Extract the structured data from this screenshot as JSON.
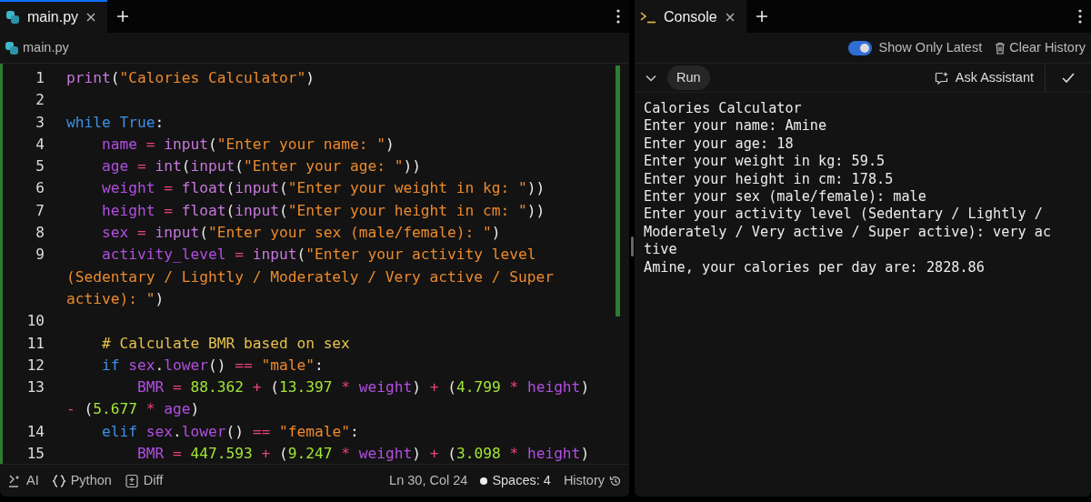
{
  "editor": {
    "tabs": [
      {
        "label": "main.py",
        "selected": true,
        "focused": true
      }
    ],
    "breadcrumb": "main.py",
    "lines": [
      {
        "number": "1",
        "rows": [
          {
            "tokens": [
              {
                "text": "print",
                "kind": "fn"
              },
              {
                "text": "(",
                "kind": "pun"
              },
              {
                "text": "\"Calories Calculator\"",
                "kind": "str"
              },
              {
                "text": ")",
                "kind": "pun"
              }
            ]
          }
        ]
      },
      {
        "number": "2",
        "rows": [
          {}
        ]
      },
      {
        "number": "3",
        "rows": [
          {
            "tokens": [
              {
                "text": "while",
                "kind": "kw"
              },
              {
                "text": " True",
                "kind": "kw"
              },
              {
                "text": ":",
                "kind": "pun"
              }
            ]
          }
        ]
      },
      {
        "number": "4",
        "rows": [
          {
            "tokens": [
              {
                "text": "    name",
                "kind": "var"
              },
              {
                "text": " = ",
                "kind": "op"
              },
              {
                "text": "input",
                "kind": "fn"
              },
              {
                "text": "(",
                "kind": "pun"
              },
              {
                "text": "\"Enter your name: \"",
                "kind": "str"
              },
              {
                "text": ")",
                "kind": "pun"
              }
            ]
          }
        ]
      },
      {
        "number": "5",
        "rows": [
          {
            "tokens": [
              {
                "text": "    age",
                "kind": "var"
              },
              {
                "text": " = ",
                "kind": "op"
              },
              {
                "text": "int",
                "kind": "fn"
              },
              {
                "text": "(",
                "kind": "pun"
              },
              {
                "text": "input",
                "kind": "fn"
              },
              {
                "text": "(",
                "kind": "pun"
              },
              {
                "text": "\"Enter your age: \"",
                "kind": "str"
              },
              {
                "text": "))",
                "kind": "pun"
              }
            ]
          }
        ]
      },
      {
        "number": "6",
        "rows": [
          {
            "tokens": [
              {
                "text": "    weight",
                "kind": "var"
              },
              {
                "text": " = ",
                "kind": "op"
              },
              {
                "text": "float",
                "kind": "fn"
              },
              {
                "text": "(",
                "kind": "pun"
              },
              {
                "text": "input",
                "kind": "fn"
              },
              {
                "text": "(",
                "kind": "pun"
              },
              {
                "text": "\"Enter your weight in kg: \"",
                "kind": "str"
              },
              {
                "text": "))",
                "kind": "pun"
              }
            ]
          }
        ]
      },
      {
        "number": "7",
        "rows": [
          {
            "tokens": [
              {
                "text": "    height",
                "kind": "var"
              },
              {
                "text": " = ",
                "kind": "op"
              },
              {
                "text": "float",
                "kind": "fn"
              },
              {
                "text": "(",
                "kind": "pun"
              },
              {
                "text": "input",
                "kind": "fn"
              },
              {
                "text": "(",
                "kind": "pun"
              },
              {
                "text": "\"Enter your height in cm: \"",
                "kind": "str"
              },
              {
                "text": "))",
                "kind": "pun"
              }
            ]
          }
        ]
      },
      {
        "number": "8",
        "rows": [
          {
            "tokens": [
              {
                "text": "    sex",
                "kind": "var"
              },
              {
                "text": " = ",
                "kind": "op"
              },
              {
                "text": "input",
                "kind": "fn"
              },
              {
                "text": "(",
                "kind": "pun"
              },
              {
                "text": "\"Enter your sex (male/female): \"",
                "kind": "str"
              },
              {
                "text": ")",
                "kind": "pun"
              }
            ]
          }
        ]
      },
      {
        "number": "9",
        "rows": [
          {
            "tokens": [
              {
                "text": "    activity_level",
                "kind": "var"
              },
              {
                "text": " = ",
                "kind": "op"
              },
              {
                "text": "input",
                "kind": "fn"
              },
              {
                "text": "(",
                "kind": "pun"
              },
              {
                "text": "\"Enter your activity level",
                "kind": "str"
              }
            ]
          },
          {
            "tokens": [
              {
                "text": "(Sedentary / Lightly / Moderately / Very active / Super",
                "kind": "str"
              }
            ]
          },
          {
            "tokens": [
              {
                "text": "active): \"",
                "kind": "str"
              },
              {
                "text": ")",
                "kind": "pun"
              }
            ]
          }
        ]
      },
      {
        "number": "10",
        "rows": [
          {}
        ]
      },
      {
        "number": "11",
        "rows": [
          {
            "tokens": [
              {
                "text": "    # Calculate BMR based on sex",
                "kind": "cmt"
              }
            ]
          }
        ]
      },
      {
        "number": "12",
        "rows": [
          {
            "tokens": [
              {
                "text": "    if",
                "kind": "kw"
              },
              {
                "text": " sex",
                "kind": "var"
              },
              {
                "text": ".",
                "kind": "pun"
              },
              {
                "text": "lower",
                "kind": "var"
              },
              {
                "text": "()",
                "kind": "pun"
              },
              {
                "text": " == ",
                "kind": "op"
              },
              {
                "text": "\"male\"",
                "kind": "str"
              },
              {
                "text": ":",
                "kind": "pun"
              }
            ]
          }
        ]
      },
      {
        "number": "13",
        "rows": [
          {
            "tokens": [
              {
                "text": "        BMR",
                "kind": "var"
              },
              {
                "text": " = ",
                "kind": "op"
              },
              {
                "text": "88.362",
                "kind": "num"
              },
              {
                "text": " + ",
                "kind": "op"
              },
              {
                "text": "(",
                "kind": "pun"
              },
              {
                "text": "13.397",
                "kind": "num"
              },
              {
                "text": " * ",
                "kind": "op"
              },
              {
                "text": "weight",
                "kind": "var"
              },
              {
                "text": ")",
                "kind": "pun"
              },
              {
                "text": " + ",
                "kind": "op"
              },
              {
                "text": "(",
                "kind": "pun"
              },
              {
                "text": "4.799",
                "kind": "num"
              },
              {
                "text": " * ",
                "kind": "op"
              },
              {
                "text": "height",
                "kind": "var"
              },
              {
                "text": ")",
                "kind": "pun"
              }
            ]
          },
          {
            "tokens": [
              {
                "text": "-",
                "kind": "op"
              },
              {
                "text": " (",
                "kind": "pun"
              },
              {
                "text": "5.677",
                "kind": "num"
              },
              {
                "text": " * ",
                "kind": "op"
              },
              {
                "text": "age",
                "kind": "var"
              },
              {
                "text": ")",
                "kind": "pun"
              }
            ]
          }
        ]
      },
      {
        "number": "14",
        "rows": [
          {
            "tokens": [
              {
                "text": "    elif",
                "kind": "kw"
              },
              {
                "text": " sex",
                "kind": "var"
              },
              {
                "text": ".",
                "kind": "pun"
              },
              {
                "text": "lower",
                "kind": "var"
              },
              {
                "text": "()",
                "kind": "pun"
              },
              {
                "text": " == ",
                "kind": "op"
              },
              {
                "text": "\"female\"",
                "kind": "str"
              },
              {
                "text": ":",
                "kind": "pun"
              }
            ]
          }
        ]
      },
      {
        "number": "15",
        "rows": [
          {
            "tokens": [
              {
                "text": "        BMR",
                "kind": "var"
              },
              {
                "text": " = ",
                "kind": "op"
              },
              {
                "text": "447.593",
                "kind": "num"
              },
              {
                "text": " + ",
                "kind": "op"
              },
              {
                "text": "(",
                "kind": "pun"
              },
              {
                "text": "9.247",
                "kind": "num"
              },
              {
                "text": " * ",
                "kind": "op"
              },
              {
                "text": "weight",
                "kind": "var"
              },
              {
                "text": ")",
                "kind": "pun"
              },
              {
                "text": " + ",
                "kind": "op"
              },
              {
                "text": "(",
                "kind": "pun"
              },
              {
                "text": "3.098",
                "kind": "num"
              },
              {
                "text": " * ",
                "kind": "op"
              },
              {
                "text": "height",
                "kind": "var"
              },
              {
                "text": ")",
                "kind": "pun"
              }
            ]
          }
        ]
      }
    ],
    "status_bar": {
      "items": [
        {
          "label": "AI",
          "kind": "ai"
        },
        {
          "label": "Python",
          "kind": "language"
        },
        {
          "label": "Diff",
          "kind": "diff"
        }
      ],
      "position": "Ln 30, Col 24",
      "spaces": "Spaces: 4",
      "history": "History"
    }
  },
  "console": {
    "tabs": [
      {
        "label": "Console",
        "selected": true,
        "focused": false
      }
    ],
    "show_only_latest": {
      "label": "Show Only Latest",
      "on": true
    },
    "clear_history": "Clear History",
    "run_button": "Run",
    "ask_assistant": "Ask Assistant",
    "output": [
      "Calories Calculator",
      "Enter your name: Amine",
      "Enter your age: 18",
      "Enter your weight in kg: 59.5",
      "Enter your height in cm: 178.5",
      "Enter your sex (male/female): male",
      "Enter your activity level (Sedentary / Lightly /",
      "Moderately / Very active / Super active): very ac",
      "tive",
      "Amine, your calories per day are: 2828.86"
    ]
  }
}
